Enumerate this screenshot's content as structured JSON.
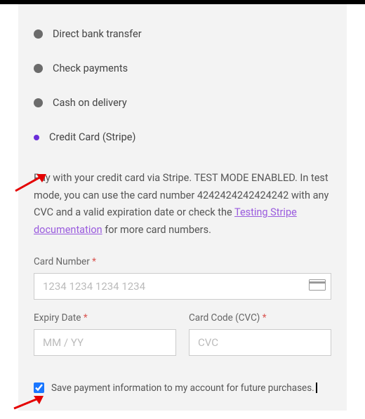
{
  "payment_methods": {
    "bank": "Direct bank transfer",
    "check": "Check payments",
    "cod": "Cash on delivery",
    "stripe": "Credit Card (Stripe)"
  },
  "stripe": {
    "desc_before_link": "Pay with your credit card via Stripe. TEST MODE ENABLED. In test mode, you can use the card number 4242424242424242 with any CVC and a valid expiration date or check the ",
    "link_text": "Testing Stripe documentation",
    "desc_after_link": " for more card numbers.",
    "card_number_label": "Card Number",
    "card_number_placeholder": "1234 1234 1234 1234",
    "expiry_label": "Expiry Date",
    "expiry_placeholder": "MM / YY",
    "cvc_label": "Card Code (CVC)",
    "cvc_placeholder": "CVC",
    "save_label": "Save payment information to my account for future purchases."
  },
  "icons": {
    "required": "*"
  }
}
